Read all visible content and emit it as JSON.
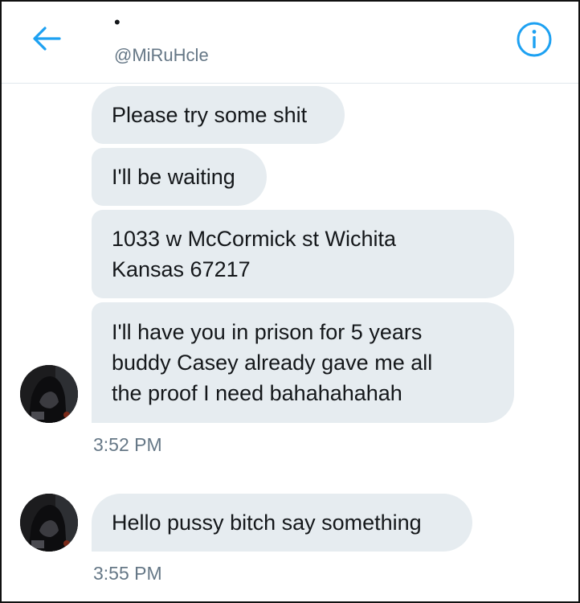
{
  "header": {
    "display_name": "•",
    "handle": "@MiRuHcle",
    "back_icon": "arrow-left-icon",
    "info_icon": "info-circle-icon",
    "accent_color": "#1da1f2"
  },
  "messages": [
    {
      "text": "Please try some shit"
    },
    {
      "text": "I'll be waiting"
    },
    {
      "text": "1033 w McCormick st Wichita\nKansas 67217"
    },
    {
      "text": "I'll have you in prison for 5 years\nbuddy Casey already gave me all\nthe proof I need bahahahahah"
    },
    {
      "text": "Hello pussy bitch say something"
    }
  ],
  "timestamps": [
    "3:52 PM",
    "3:55 PM"
  ],
  "colors": {
    "bubble": "#e6ecf0",
    "timestamp": "#657786",
    "text": "#14171a"
  }
}
